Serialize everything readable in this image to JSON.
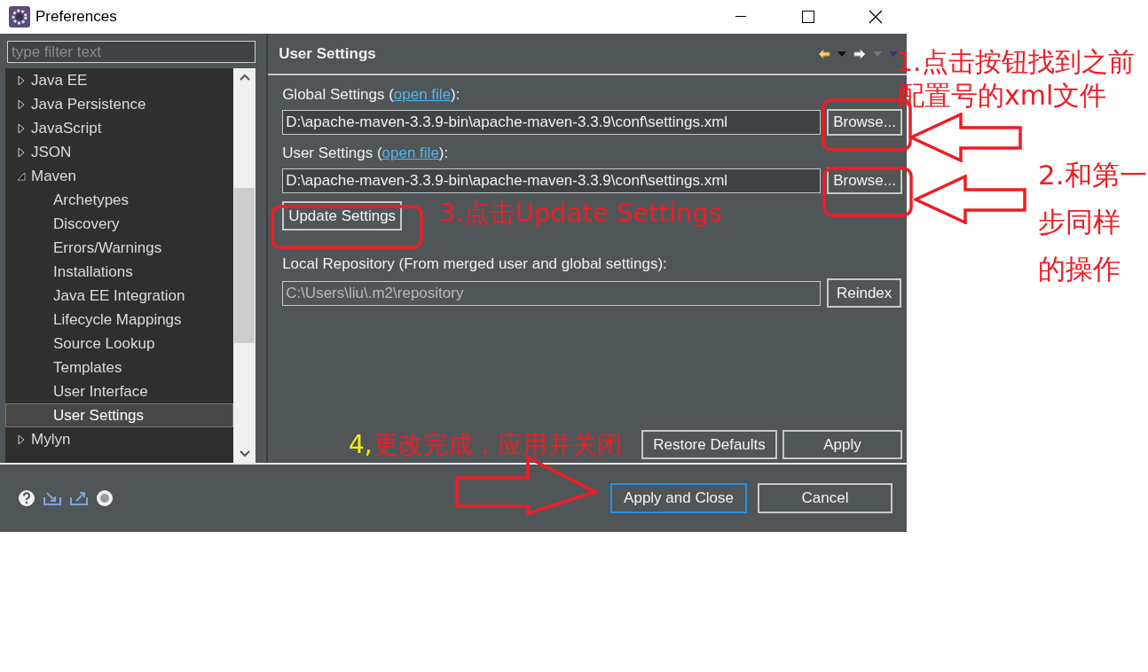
{
  "window": {
    "title": "Preferences"
  },
  "filter": {
    "placeholder": "type filter text"
  },
  "tree": [
    {
      "label": "Java EE",
      "expanded": false,
      "selected": false
    },
    {
      "label": "Java Persistence",
      "expanded": false,
      "selected": false
    },
    {
      "label": "JavaScript",
      "expanded": false,
      "selected": false
    },
    {
      "label": "JSON",
      "expanded": false,
      "selected": false
    },
    {
      "label": "Maven",
      "expanded": true,
      "selected": false,
      "children": [
        {
          "label": "Archetypes",
          "selected": false
        },
        {
          "label": "Discovery",
          "selected": false
        },
        {
          "label": "Errors/Warnings",
          "selected": false
        },
        {
          "label": "Installations",
          "selected": false
        },
        {
          "label": "Java EE Integration",
          "selected": false
        },
        {
          "label": "Lifecycle Mappings",
          "selected": false
        },
        {
          "label": "Source Lookup",
          "selected": false
        },
        {
          "label": "Templates",
          "selected": false
        },
        {
          "label": "User Interface",
          "selected": false
        },
        {
          "label": "User Settings",
          "selected": true
        }
      ]
    },
    {
      "label": "Mylyn",
      "expanded": false,
      "selected": false
    }
  ],
  "page": {
    "title": "User Settings"
  },
  "settings": [
    {
      "label_before": "Global Settings (",
      "link": "open file",
      "label_after": "):",
      "value": "D:\\apache-maven-3.3.9-bin\\apache-maven-3.3.9\\conf\\settings.xml",
      "button": "Browse..."
    },
    {
      "label_before": "User Settings (",
      "link": "open file",
      "label_after": "):",
      "value": "D:\\apache-maven-3.3.9-bin\\apache-maven-3.3.9\\conf\\settings.xml",
      "button": "Browse..."
    }
  ],
  "update_button": "Update Settings",
  "local_repository": {
    "label": "Local Repository (From merged user and global settings):",
    "value": "C:\\Users\\liu\\.m2\\repository",
    "disabled": true,
    "button": "Reindex"
  },
  "page_buttons": [
    "Restore Defaults",
    "Apply"
  ],
  "dialog_buttons": [
    {
      "label": "Apply and Close",
      "default": true
    },
    {
      "label": "Cancel",
      "default": false
    }
  ],
  "annotations": [
    {
      "text": "1.点击按钮找到之前",
      "color": "#ee1c24"
    },
    {
      "text": "配置号的xml文件",
      "color": "#ee1c24"
    },
    {
      "text": "2.和第一",
      "color": "#ee1c24"
    },
    {
      "text": "步同样",
      "color": "#ee1c24"
    },
    {
      "text": "的操作",
      "color": "#ee1c24"
    },
    {
      "text": "3.点击Update Settings",
      "color": "#ee1c24"
    },
    {
      "text": "4,",
      "color": "#f5f000"
    },
    {
      "text": "更改完成，应用并关闭",
      "color": "#ee1c24"
    }
  ]
}
